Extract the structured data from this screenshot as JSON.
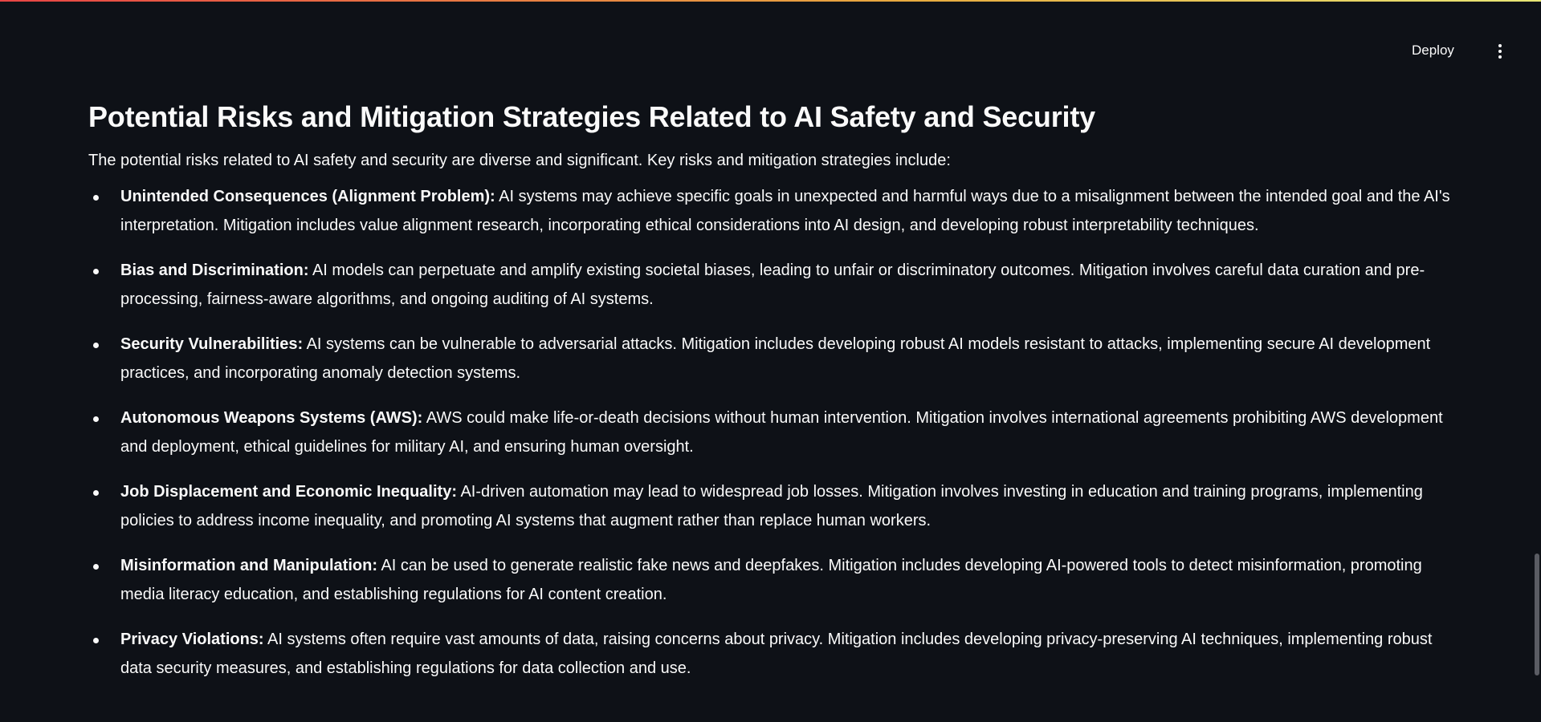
{
  "header": {
    "deploy_label": "Deploy",
    "menu_icon": "kebab-menu-icon"
  },
  "main": {
    "title": "Potential Risks and Mitigation Strategies Related to AI Safety and Security",
    "intro": "The potential risks related to AI safety and security are diverse and significant. Key risks and mitigation strategies include:",
    "risks": [
      {
        "name": "Unintended Consequences (Alignment Problem):",
        "text": " AI systems may achieve specific goals in unexpected and harmful ways due to a misalignment between the intended goal and the AI's interpretation. Mitigation includes value alignment research, incorporating ethical considerations into AI design, and developing robust interpretability techniques."
      },
      {
        "name": "Bias and Discrimination:",
        "text": " AI models can perpetuate and amplify existing societal biases, leading to unfair or discriminatory outcomes. Mitigation involves careful data curation and pre-processing, fairness-aware algorithms, and ongoing auditing of AI systems."
      },
      {
        "name": "Security Vulnerabilities:",
        "text": " AI systems can be vulnerable to adversarial attacks. Mitigation includes developing robust AI models resistant to attacks, implementing secure AI development practices, and incorporating anomaly detection systems."
      },
      {
        "name": "Autonomous Weapons Systems (AWS):",
        "text": " AWS could make life-or-death decisions without human intervention. Mitigation involves international agreements prohibiting AWS development and deployment, ethical guidelines for military AI, and ensuring human oversight."
      },
      {
        "name": "Job Displacement and Economic Inequality:",
        "text": " AI-driven automation may lead to widespread job losses. Mitigation involves investing in education and training programs, implementing policies to address income inequality, and promoting AI systems that augment rather than replace human workers."
      },
      {
        "name": "Misinformation and Manipulation:",
        "text": " AI can be used to generate realistic fake news and deepfakes. Mitigation includes developing AI-powered tools to detect misinformation, promoting media literacy education, and establishing regulations for AI content creation."
      },
      {
        "name": "Privacy Violations:",
        "text": " AI systems often require vast amounts of data, raising concerns about privacy. Mitigation includes developing privacy-preserving AI techniques, implementing robust data security measures, and establishing regulations for data collection and use."
      }
    ]
  },
  "colors": {
    "background": "#0e1117",
    "text": "#fafafa",
    "gradient_start": "#ff4b4b",
    "gradient_end": "#fffd80"
  }
}
